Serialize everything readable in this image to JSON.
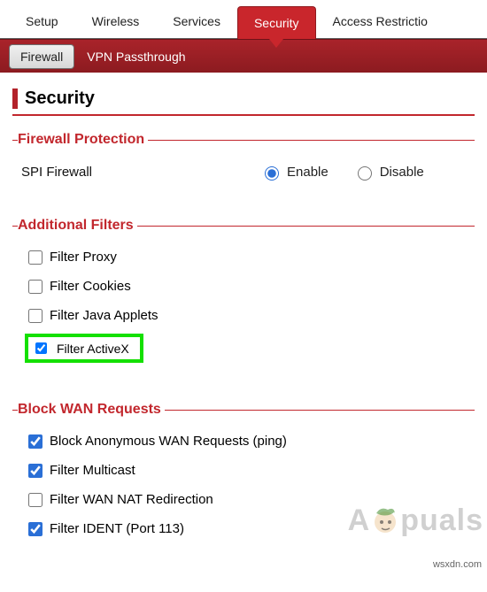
{
  "tabs": {
    "setup": "Setup",
    "wireless": "Wireless",
    "services": "Services",
    "security": "Security",
    "access": "Access Restrictio"
  },
  "subtabs": {
    "firewall": "Firewall",
    "vpn": "VPN Passthrough"
  },
  "page_title": "Security",
  "firewall_protection": {
    "legend": "Firewall Protection",
    "spi_label": "SPI Firewall",
    "enable_label": "Enable",
    "disable_label": "Disable",
    "value": "enable"
  },
  "additional_filters": {
    "legend": "Additional Filters",
    "items": [
      {
        "label": "Filter Proxy",
        "checked": false
      },
      {
        "label": "Filter Cookies",
        "checked": false
      },
      {
        "label": "Filter Java Applets",
        "checked": false
      },
      {
        "label": "Filter ActiveX",
        "checked": true,
        "highlighted": true
      }
    ]
  },
  "block_wan": {
    "legend": "Block WAN Requests",
    "items": [
      {
        "label": "Block Anonymous WAN Requests (ping)",
        "checked": true
      },
      {
        "label": "Filter Multicast",
        "checked": true
      },
      {
        "label": "Filter WAN NAT Redirection",
        "checked": false
      },
      {
        "label": "Filter IDENT (Port 113)",
        "checked": true
      }
    ]
  },
  "watermark": {
    "pre": "A",
    "post": "puals"
  },
  "source": "wsxdn.com"
}
